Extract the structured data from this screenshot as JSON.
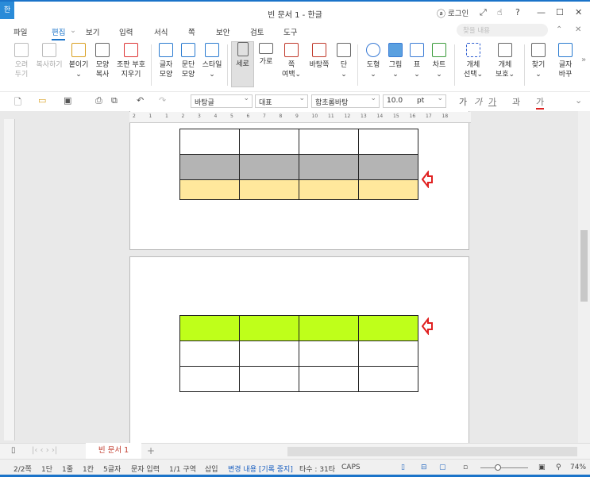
{
  "window": {
    "title": "빈 문서 1 - 한글",
    "app_icon": "한",
    "login": "로그인",
    "help": "?"
  },
  "menu": {
    "items": [
      "파일",
      "편집",
      "보기",
      "입력",
      "서식",
      "쪽",
      "보안",
      "검토",
      "도구"
    ],
    "active": "편집",
    "search_placeholder": "찾을 내용"
  },
  "ribbon": {
    "buttons": [
      {
        "l1": "오려",
        "l2": "두기",
        "icon": "scissors-icon",
        "disabled": true
      },
      {
        "l1": "복사하기",
        "l2": "",
        "icon": "copy-icon",
        "disabled": true
      },
      {
        "l1": "붙이기",
        "l2": "⌄",
        "icon": "paste-icon"
      },
      {
        "l1": "모양",
        "l2": "복사",
        "icon": "format-painter-icon"
      },
      {
        "l1": "조판 부호",
        "l2": "지우기",
        "icon": "clear-codes-icon"
      },
      {
        "l1": "글자",
        "l2": "모양",
        "icon": "char-shape-icon"
      },
      {
        "l1": "문단",
        "l2": "모양",
        "icon": "para-shape-icon"
      },
      {
        "l1": "스타일",
        "l2": "⌄",
        "icon": "style-icon"
      },
      {
        "l1": "세로",
        "l2": "",
        "icon": "portrait-icon",
        "selected": true
      },
      {
        "l1": "가로",
        "l2": "",
        "icon": "landscape-icon"
      },
      {
        "l1": "쪽",
        "l2": "여백⌄",
        "icon": "page-margin-icon"
      },
      {
        "l1": "바탕쪽",
        "l2": "",
        "icon": "master-page-icon"
      },
      {
        "l1": "단",
        "l2": "⌄",
        "icon": "columns-icon"
      },
      {
        "l1": "도형",
        "l2": "⌄",
        "icon": "shape-icon"
      },
      {
        "l1": "그림",
        "l2": "⌄",
        "icon": "picture-icon"
      },
      {
        "l1": "표",
        "l2": "⌄",
        "icon": "table-icon"
      },
      {
        "l1": "차트",
        "l2": "⌄",
        "icon": "chart-icon"
      },
      {
        "l1": "개체",
        "l2": "선택⌄",
        "icon": "object-select-icon"
      },
      {
        "l1": "개체",
        "l2": "보호⌄",
        "icon": "object-protect-icon"
      },
      {
        "l1": "찾기",
        "l2": "⌄",
        "icon": "find-icon"
      },
      {
        "l1": "글자",
        "l2": "바꾸",
        "icon": "replace-icon"
      }
    ]
  },
  "toolbar": {
    "style": "바탕글",
    "lang": "대표",
    "font": "함초롬바탕",
    "size": "10.0",
    "unit": "pt",
    "fmt": [
      "가",
      "가",
      "가",
      "과",
      "가"
    ]
  },
  "ruler": {
    "ticks": [
      "2",
      "1",
      "1",
      "2",
      "3",
      "4",
      "5",
      "6",
      "7",
      "8",
      "9",
      "10",
      "11",
      "12",
      "13",
      "14",
      "15",
      "16",
      "17",
      "18"
    ]
  },
  "document": {
    "table1_colors": [
      "#ffffff",
      "#b4b4b4",
      "#ffe89c"
    ],
    "table2_colors": [
      "#bfff1a",
      "#ffffff",
      "#ffffff"
    ],
    "arrow_color": "#e02020"
  },
  "tabs": {
    "doc_tab": "빈 문서 1",
    "add": "+"
  },
  "status": {
    "page": "2/2쪽",
    "col": "1단",
    "line": "1줄",
    "pos": "1칸",
    "chars": "5글자",
    "mode": "문자 입력",
    "section": "1/1 구역",
    "insert": "삽입",
    "track": "변경 내용 [기록 중지]",
    "typing": "타수 : 31타",
    "caps": "CAPS",
    "zoom": "74%"
  }
}
